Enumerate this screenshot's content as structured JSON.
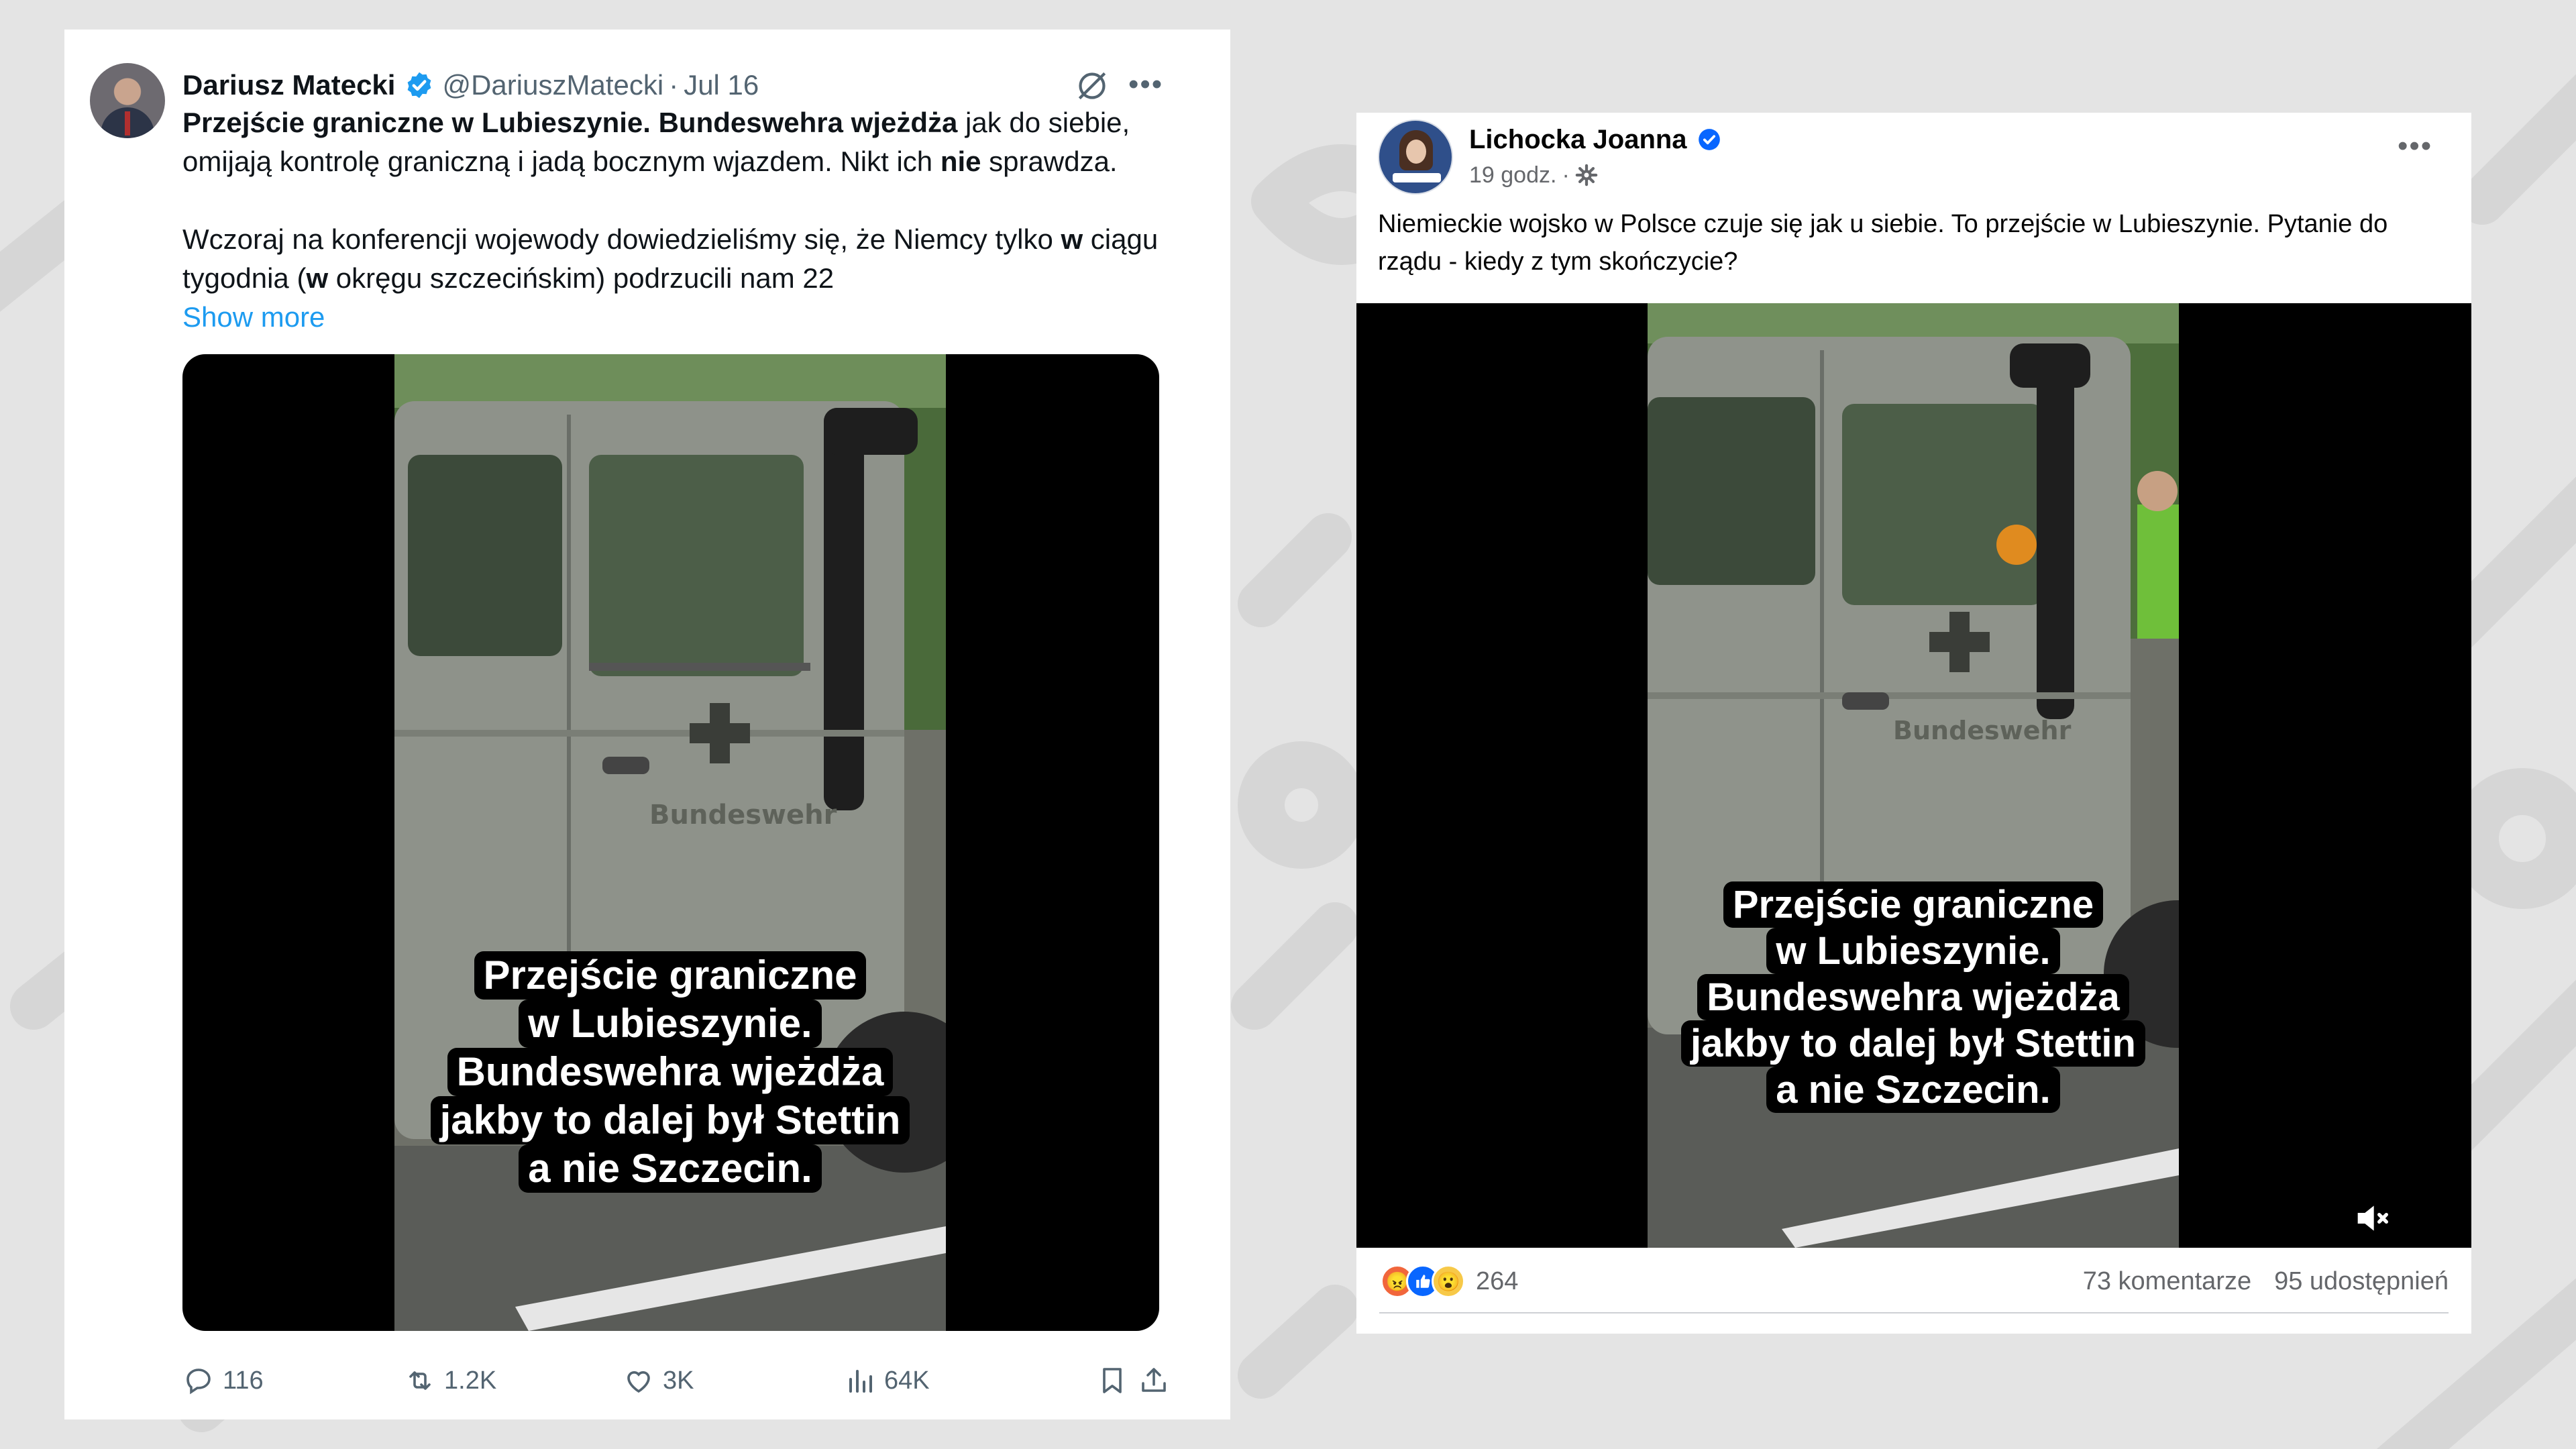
{
  "tweet": {
    "author_name": "Dariusz Matecki",
    "handle": "@DariuszMatecki",
    "separator": "·",
    "date": "Jul 16",
    "more_icon": "more-horizontal-icon",
    "text_bold_1": "Przejście graniczne w Lubieszynie. Bundeswehra wjeżdża",
    "text_1": " jak do siebie, omijają kontrolę graniczną i jadą bocznym wjazdem. Nikt ich ",
    "text_bold_2": "nie",
    "text_2": " sprawdza.",
    "text_3": "Wczoraj na konferencji wojewody dowiedzieliśmy się, że Niemcy tylko ",
    "text_bold_3": "w",
    "text_4": " ciągu tygodnia (",
    "text_bold_4": "w",
    "text_5": " okręgu szczecińskim) podrzucili nam 22",
    "show_more": "Show more",
    "video": {
      "vehicle_text": "Bundeswehr",
      "caption_lines": [
        "Przejście graniczne",
        "w Lubieszynie.",
        "Bundeswehra wjeżdża",
        "jakby to dalej był Stettin",
        "a nie Szczecin."
      ]
    },
    "actions": {
      "replies": "116",
      "reposts": "1.2K",
      "likes": "3K",
      "views": "64K"
    },
    "accent_color": "#1d9bf0"
  },
  "facebook_post": {
    "author_name": "Lichocka Joanna",
    "time": "19 godz.",
    "separator": "·",
    "text": "Niemieckie wojsko w Polsce czuje się jak u siebie. To przejście w Lubieszynie. Pytanie do rządu - kiedy z tym skończycie?",
    "video": {
      "vehicle_text": "Bundeswehr",
      "caption_lines": [
        "Przejście graniczne",
        "w Lubieszynie.",
        "Bundeswehra wjeżdża",
        "jakby to dalej był Stettin",
        "a nie Szczecin."
      ]
    },
    "reactions": [
      "angry-reaction-icon",
      "like-reaction-icon",
      "wow-reaction-icon"
    ],
    "reaction_count": "264",
    "comments": "73 komentarze",
    "shares": "95 udostępnień",
    "accent_color": "#0866ff"
  }
}
